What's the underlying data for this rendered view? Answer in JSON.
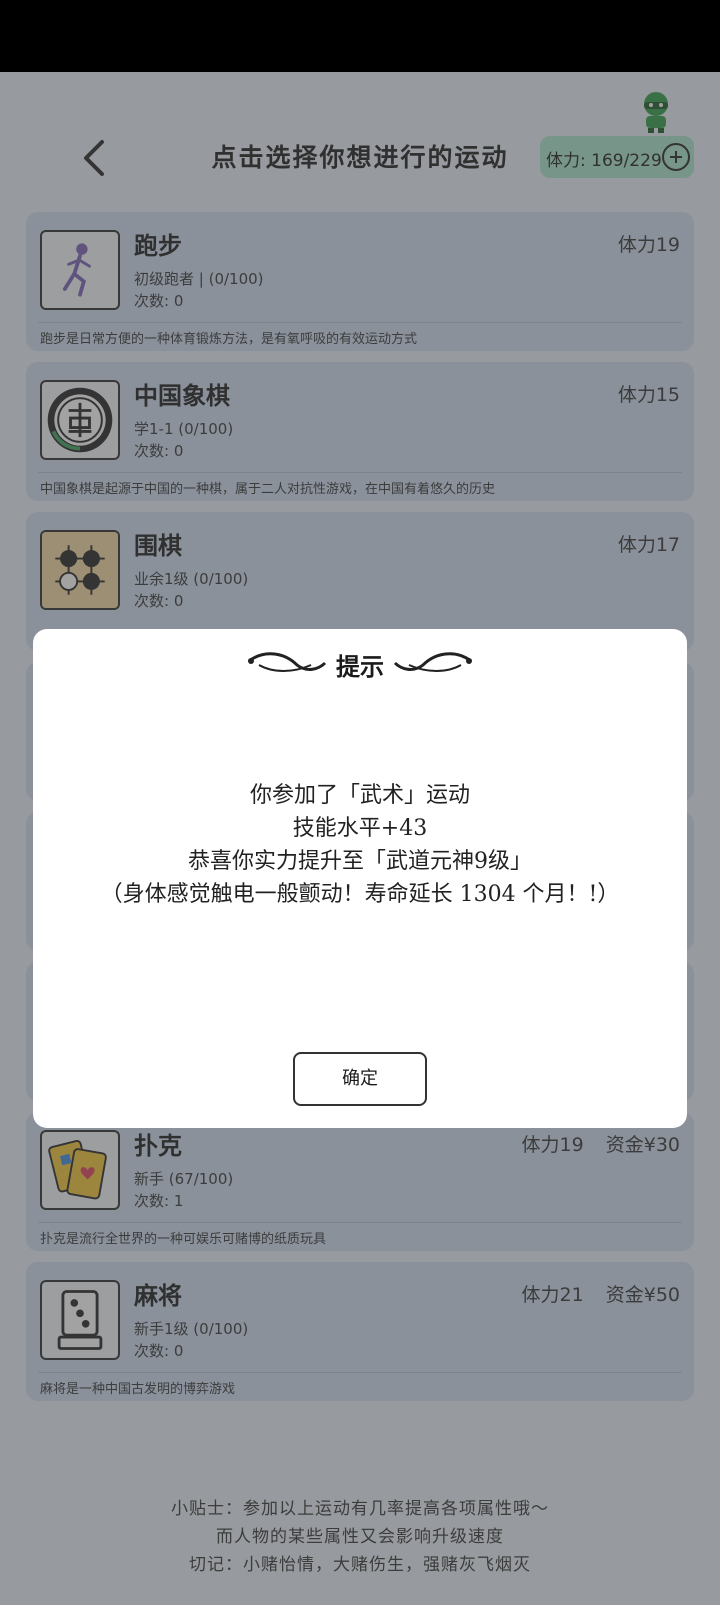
{
  "header": {
    "title": "点击选择你想进行的运动",
    "stamina": "体力: 169/229"
  },
  "activities": [
    {
      "name": "跑步",
      "level": "初级跑者 | (0/100)",
      "count": "次数: 0",
      "stamina": "体力19",
      "cost": "",
      "description": "跑步是日常方便的一种体育锻炼方法，是有氧呼吸的有效运动方式"
    },
    {
      "name": "中国象棋",
      "level": "学1-1 (0/100)",
      "count": "次数: 0",
      "stamina": "体力15",
      "cost": "",
      "description": "中国象棋是起源于中国的一种棋，属于二人对抗性游戏，在中国有着悠久的历史"
    },
    {
      "name": "围棋",
      "level": "业余1级 (0/100)",
      "count": "次数: 0",
      "stamina": "体力17",
      "cost": "",
      "description": ""
    },
    {
      "name": "扑克",
      "level": "新手 (67/100)",
      "count": "次数: 1",
      "stamina": "体力19",
      "cost": "资金¥30",
      "description": "扑克是流行全世界的一种可娱乐可赌博的纸质玩具"
    },
    {
      "name": "麻将",
      "level": "新手1级 (0/100)",
      "count": "次数: 0",
      "stamina": "体力21",
      "cost": "资金¥50",
      "description": "麻将是一种中国古发明的博弈游戏"
    }
  ],
  "tips": {
    "line1": "小贴士：参加以上运动有几率提高各项属性哦～",
    "line2": "而人物的某些属性又会影响升级速度",
    "line3": "切记：小赌怡情，大赌伤生，强赌灰飞烟灭"
  },
  "modal": {
    "title": "提示",
    "line1": "你参加了「武术」运动",
    "line2": "技能水平+43",
    "line3": "恭喜你实力提升至「武道元神9级」",
    "line4": "（身体感觉触电一般颤动！寿命延长 1304 个月！!）",
    "confirm": "确定"
  },
  "colors": {
    "card_bg": "#cfdcf0",
    "stamina_pill": "#a9e4cc",
    "overlay": "rgba(70,70,70,0.5)"
  }
}
